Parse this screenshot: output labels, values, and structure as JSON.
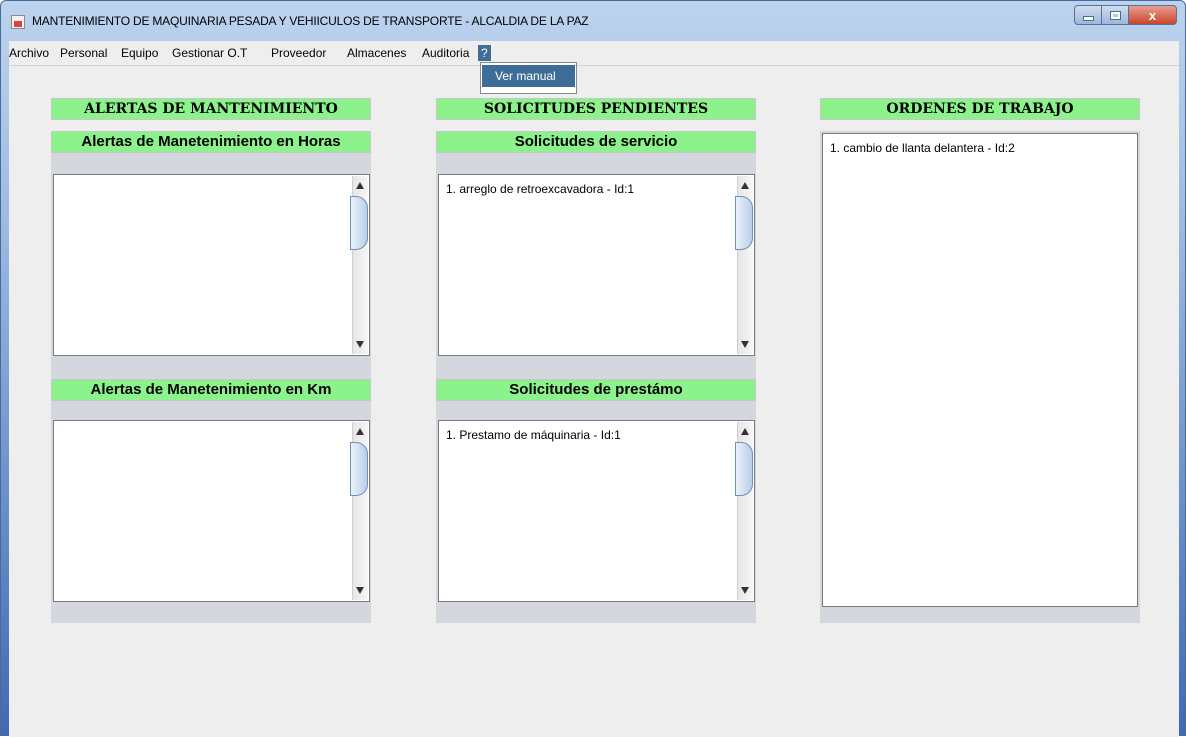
{
  "window": {
    "title": "MANTENIMIENTO DE MAQUINARIA PESADA Y VEHIICULOS DE TRANSPORTE - ALCALDIA DE LA PAZ",
    "close_label": "x"
  },
  "menubar": {
    "items": [
      "Archivo",
      "Personal",
      "Equipo",
      "Gestionar O.T",
      "Proveedor",
      "Almacenes",
      "Auditoria",
      "?"
    ],
    "open_menu": "?",
    "popup_items": [
      "Ver manual"
    ]
  },
  "alerts": {
    "header": "ALERTAS DE MANTENIMIENTO",
    "hours": {
      "title": "Alertas de Manetenimiento en Horas",
      "items": []
    },
    "km": {
      "title": "Alertas de Manetenimiento en Km",
      "items": []
    }
  },
  "requests": {
    "header": "SOLICITUDES PENDIENTES",
    "service": {
      "title": "Solicitudes de servicio",
      "items": [
        "1. arreglo de retroexcavadora - Id:1"
      ]
    },
    "loan": {
      "title": "Solicitudes de prestámo",
      "items": [
        "1. Prestamo de máquinaria - Id:1"
      ]
    }
  },
  "work_orders": {
    "header": "ORDENES DE TRABAJO",
    "items": [
      "1. cambio de llanta delantera - Id:2"
    ]
  },
  "colors": {
    "panel_header_bg": "#8cf28c",
    "menu_highlight": "#3e6e97",
    "well_bg": "#d4d7dd"
  }
}
